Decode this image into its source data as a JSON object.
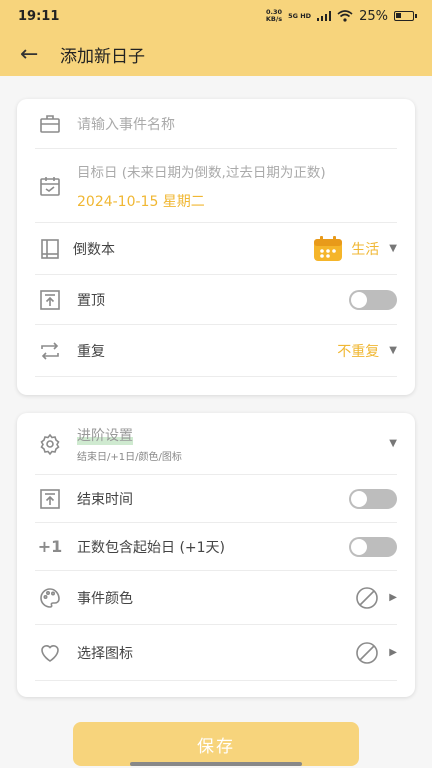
{
  "status": {
    "time": "19:11",
    "net_speed_top": "0.30",
    "net_speed_bottom": "KB/s",
    "network": "5G HD",
    "battery": "25%"
  },
  "appbar": {
    "back_icon": "arrow-left-icon",
    "title": "添加新日子"
  },
  "card1": {
    "event_name_placeholder": "请输入事件名称",
    "target_day_label": "目标日 (未来日期为倒数,过去日期为正数)",
    "target_date": "2024-10-15 星期二",
    "book_label": "倒数本",
    "book_value": "生活",
    "pin_label": "置顶",
    "repeat_label": "重复",
    "repeat_value": "不重复"
  },
  "card2": {
    "advanced_title": "进阶设置",
    "advanced_sub": "结束日/+1日/颜色/图标",
    "end_time_label": "结束时间",
    "plus_one_icon_text": "+1",
    "include_start_label": "正数包含起始日 (+1天)",
    "event_color_label": "事件颜色",
    "choose_icon_label": "选择图标"
  },
  "save_label": "保存",
  "colors": {
    "accent": "#f0b733",
    "header": "#f7d47c",
    "toggle_off": "#bdbdbd"
  }
}
